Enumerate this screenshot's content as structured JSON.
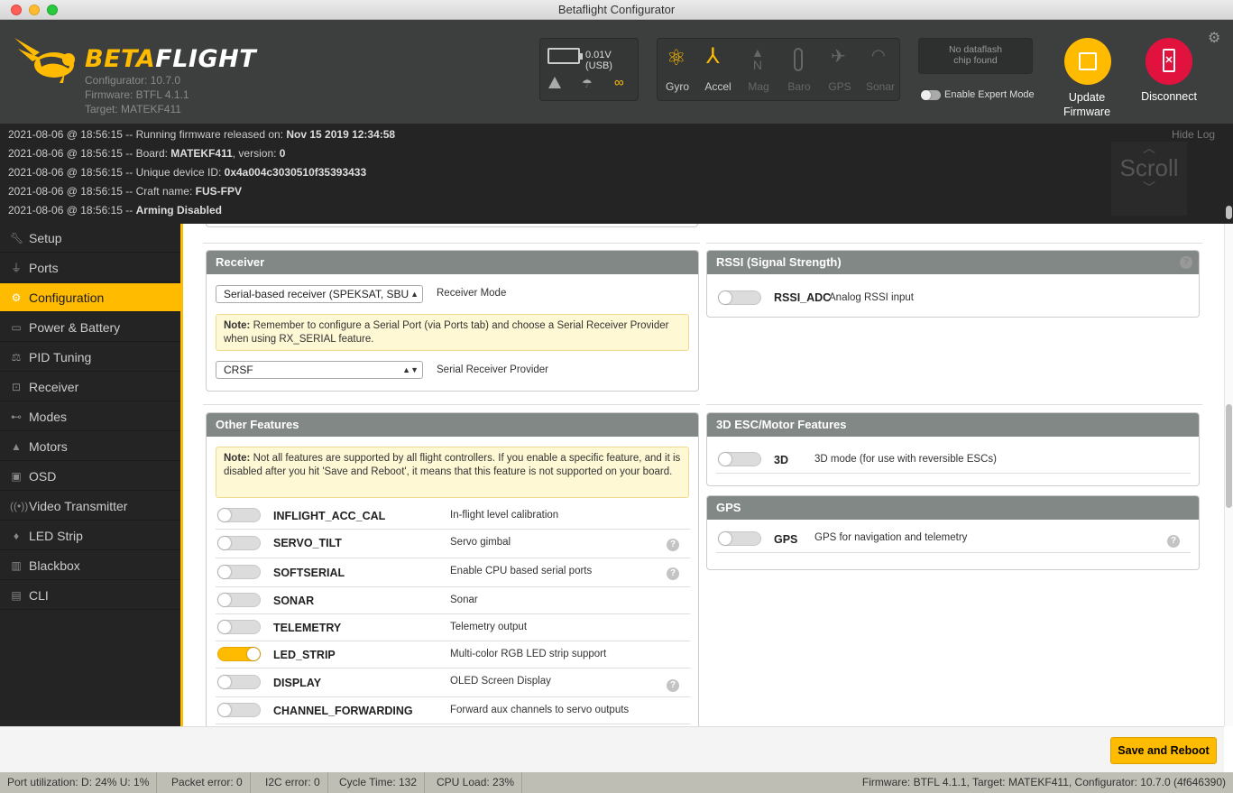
{
  "window": {
    "title": "Betaflight Configurator"
  },
  "header": {
    "logo_part1": "BETA",
    "logo_part2": "FLIGHT",
    "configurator": "Configurator: 10.7.0",
    "firmware": "Firmware: BTFL 4.1.1",
    "target": "Target: MATEKF411",
    "battery": "0.01V (USB)",
    "sensors": [
      {
        "label": "Gyro",
        "active": true,
        "icon": "gyro-icon"
      },
      {
        "label": "Accel",
        "active": true,
        "icon": "accel-icon"
      },
      {
        "label": "Mag",
        "active": false,
        "icon": "mag-icon"
      },
      {
        "label": "Baro",
        "active": false,
        "icon": "baro-icon"
      },
      {
        "label": "GPS",
        "active": false,
        "icon": "gps-icon"
      },
      {
        "label": "Sonar",
        "active": false,
        "icon": "sonar-icon"
      }
    ],
    "dataflash_line1": "No dataflash",
    "dataflash_line2": "chip found",
    "expert_mode": "Enable Expert Mode",
    "update_line1": "Update",
    "update_line2": "Firmware",
    "disconnect": "Disconnect"
  },
  "log": {
    "hide": "Hide Log",
    "scroll": "Scroll",
    "lines": [
      {
        "prefix": "2021-08-06 @ 18:56:15 -- Running firmware released on: ",
        "value": "Nov 15 2019 12:34:58",
        "suffix": ""
      },
      {
        "prefix": "2021-08-06 @ 18:56:15 -- Board: ",
        "value": "MATEKF411",
        "suffix": ", version: ",
        "value2": "0"
      },
      {
        "prefix": "2021-08-06 @ 18:56:15 -- Unique device ID: ",
        "value": "0x4a004c3030510f35393433",
        "suffix": ""
      },
      {
        "prefix": "2021-08-06 @ 18:56:15 -- Craft name: ",
        "value": "FUS-FPV",
        "suffix": ""
      },
      {
        "prefix": "2021-08-06 @ 18:56:15 -- ",
        "value": "Arming Disabled",
        "suffix": ""
      }
    ]
  },
  "sidebar": {
    "items": [
      {
        "label": "Setup",
        "icon": "wrench-icon"
      },
      {
        "label": "Ports",
        "icon": "plug-icon"
      },
      {
        "label": "Configuration",
        "icon": "gear-icon",
        "active": true
      },
      {
        "label": "Power & Battery",
        "icon": "battery-icon"
      },
      {
        "label": "PID Tuning",
        "icon": "pid-icon"
      },
      {
        "label": "Receiver",
        "icon": "receiver-icon"
      },
      {
        "label": "Modes",
        "icon": "toggle-icon"
      },
      {
        "label": "Motors",
        "icon": "motor-icon"
      },
      {
        "label": "OSD",
        "icon": "osd-icon"
      },
      {
        "label": "Video Transmitter",
        "icon": "antenna-icon"
      },
      {
        "label": "LED Strip",
        "icon": "led-icon"
      },
      {
        "label": "Blackbox",
        "icon": "blackbox-icon"
      },
      {
        "label": "CLI",
        "icon": "terminal-icon"
      }
    ]
  },
  "receiver": {
    "title": "Receiver",
    "mode_value": "Serial-based receiver (SPEKSAT, SBUS, SUMD)",
    "mode_label": "Receiver Mode",
    "note_bold": "Note:",
    "note_text": " Remember to configure a Serial Port (via Ports tab) and choose a Serial Receiver Provider when using RX_SERIAL feature.",
    "provider_value": "CRSF",
    "provider_label": "Serial Receiver Provider"
  },
  "rssi": {
    "title": "RSSI (Signal Strength)",
    "name": "RSSI_ADC",
    "desc": "Analog RSSI input"
  },
  "other": {
    "title": "Other Features",
    "note_bold": "Note:",
    "note_text": " Not all features are supported by all flight controllers. If you enable a specific feature, and it is disabled after you hit 'Save and Reboot', it means that this feature is not supported on your board.",
    "features": [
      {
        "name": "INFLIGHT_ACC_CAL",
        "desc": "In-flight level calibration",
        "on": false,
        "help": false
      },
      {
        "name": "SERVO_TILT",
        "desc": "Servo gimbal",
        "on": false,
        "help": true
      },
      {
        "name": "SOFTSERIAL",
        "desc": "Enable CPU based serial ports",
        "on": false,
        "help": true
      },
      {
        "name": "SONAR",
        "desc": "Sonar",
        "on": false,
        "help": false
      },
      {
        "name": "TELEMETRY",
        "desc": "Telemetry output",
        "on": false,
        "help": false
      },
      {
        "name": "LED_STRIP",
        "desc": "Multi-color RGB LED strip support",
        "on": true,
        "help": false
      },
      {
        "name": "DISPLAY",
        "desc": "OLED Screen Display",
        "on": false,
        "help": true
      },
      {
        "name": "CHANNEL_FORWARDING",
        "desc": "Forward aux channels to servo outputs",
        "on": false,
        "help": false
      }
    ]
  },
  "esc3d": {
    "title": "3D ESC/Motor Features",
    "name": "3D",
    "desc": "3D mode (for use with reversible ESCs)"
  },
  "gps": {
    "title": "GPS",
    "name": "GPS",
    "desc": "GPS for navigation and telemetry"
  },
  "footer": {
    "save": "Save and Reboot"
  },
  "status": {
    "port": "Port utilization: D: 24% U: 1%",
    "packet": "Packet error: 0",
    "i2c": "I2C error: 0",
    "cycle": "Cycle Time: 132",
    "cpu": "CPU Load: 23%",
    "version": "Firmware: BTFL 4.1.1, Target: MATEKF411, Configurator: 10.7.0 (4f646390)"
  },
  "colors": {
    "accent": "#ffbb00",
    "header_bg": "#3d3f3e",
    "log_bg": "#242424",
    "disconnect": "#e2123f"
  }
}
